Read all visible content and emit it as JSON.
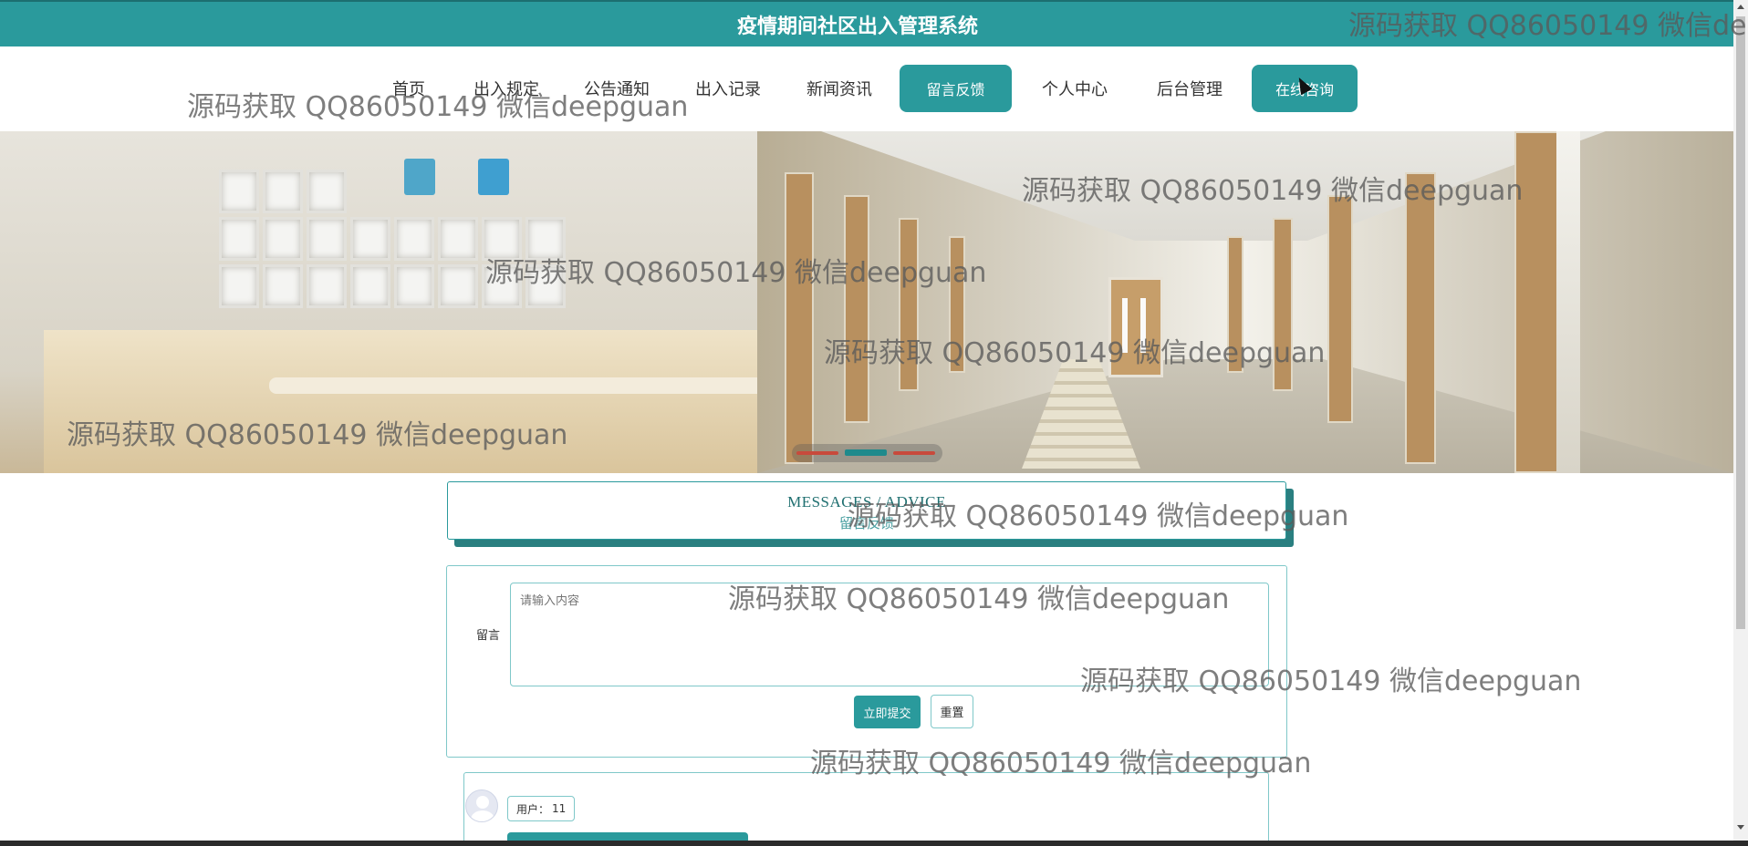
{
  "app": {
    "title": "疫情期间社区出入管理系统"
  },
  "nav": {
    "items": [
      {
        "label": "首页",
        "active": false
      },
      {
        "label": "出入规定",
        "active": false
      },
      {
        "label": "公告通知",
        "active": false
      },
      {
        "label": "出入记录",
        "active": false
      },
      {
        "label": "新闻资讯",
        "active": false
      },
      {
        "label": "留言反馈",
        "active": true
      },
      {
        "label": "个人中心",
        "active": false
      },
      {
        "label": "后台管理",
        "active": false
      },
      {
        "label": "在线咨询",
        "active": true
      }
    ]
  },
  "banner": {
    "slide_count": 3,
    "current_slide": 2
  },
  "section": {
    "title_en": "MESSAGES / ADVICE",
    "title_cn": "留言反馈"
  },
  "form": {
    "label": "留言",
    "placeholder": "请输入内容",
    "value": "",
    "submit_label": "立即提交",
    "reset_label": "重置"
  },
  "messages": [
    {
      "user_prefix": "用户：",
      "user": "11"
    }
  ],
  "watermark_text": "源码获取 QQ86050149 微信deepguan",
  "colors": {
    "primary": "#2a9a9c",
    "primary_dark": "#2a7f80",
    "border": "#7fc8c9"
  }
}
